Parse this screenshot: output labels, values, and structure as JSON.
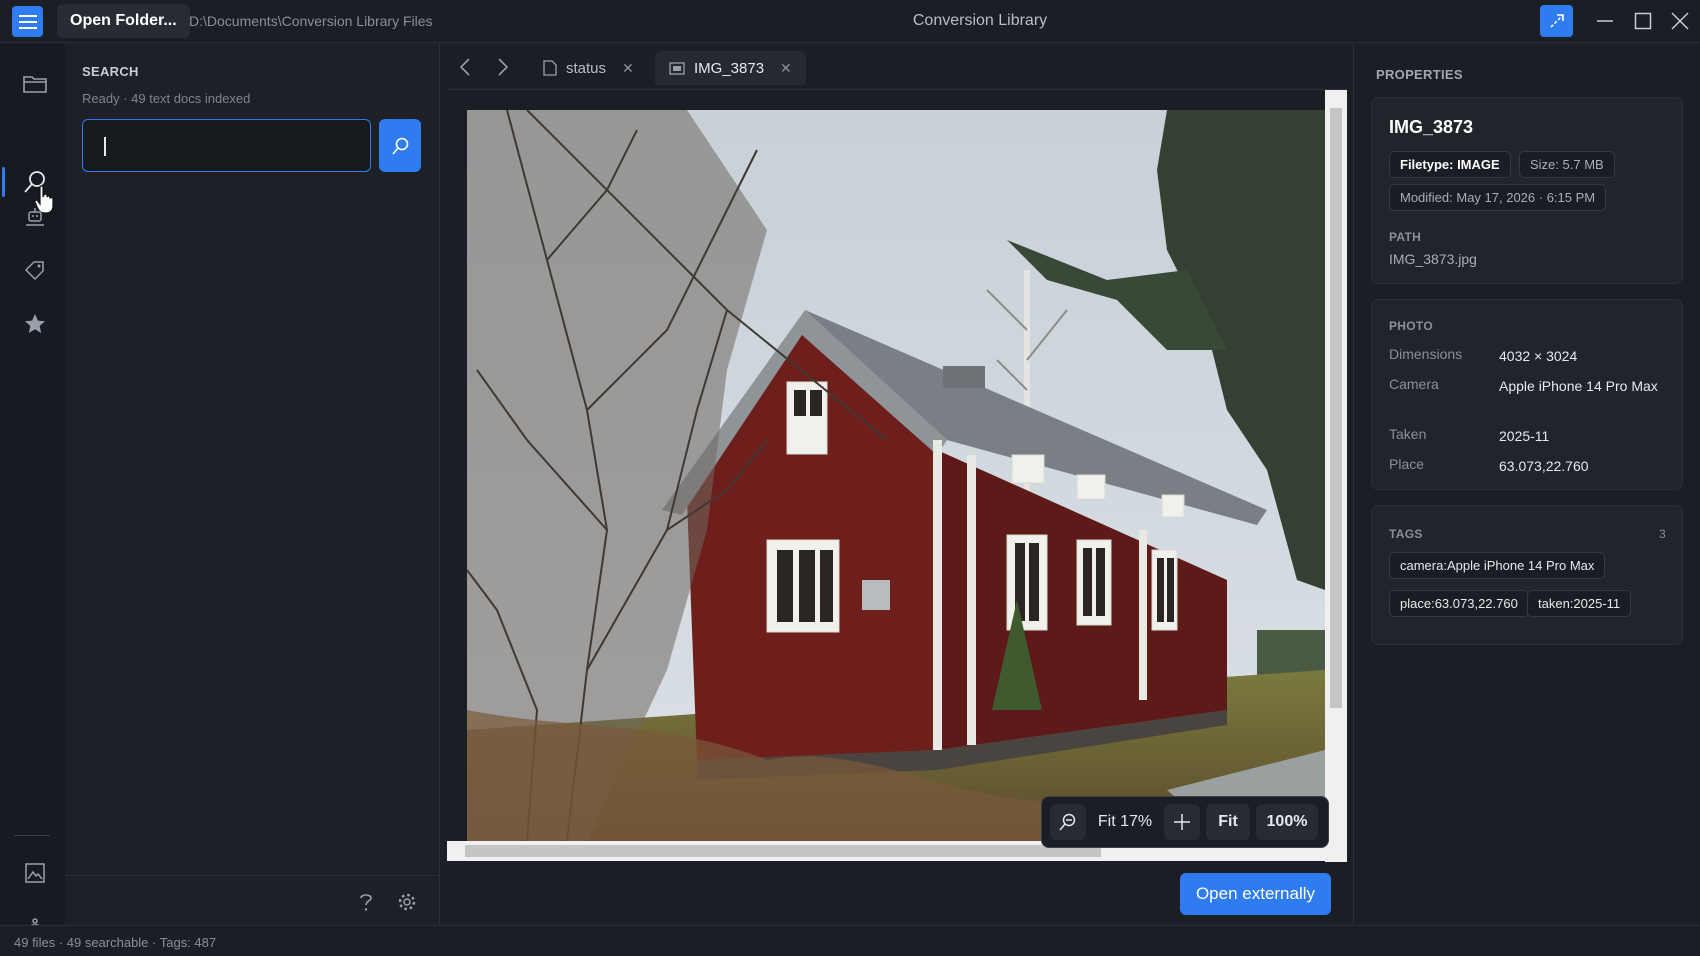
{
  "titlebar": {
    "open_folder_label": "Open Folder...",
    "path": "D:\\Documents\\Conversion Library Files",
    "app_title": "Conversion Library"
  },
  "search": {
    "title": "SEARCH",
    "status": "Ready · 49 text docs indexed",
    "query": "",
    "placeholder": ""
  },
  "tabs": [
    {
      "label": "status",
      "active": false
    },
    {
      "label": "IMG_3873",
      "active": true
    }
  ],
  "viewer": {
    "zoom_label": "Fit 17%",
    "fit_label": "Fit",
    "actual_label": "100%",
    "open_externally_label": "Open externally"
  },
  "properties": {
    "title": "PROPERTIES",
    "file_name": "IMG_3873",
    "filetype": "Filetype: IMAGE",
    "size": "Size: 5.7 MB",
    "modified": "Modified: May 17, 2026 · 6:15 PM",
    "path_label": "PATH",
    "path_value": "IMG_3873.jpg",
    "photo_label": "PHOTO",
    "photo": [
      {
        "key": "Dimensions",
        "value": "4032 × 3024"
      },
      {
        "key": "Camera",
        "value": "Apple iPhone 14 Pro Max"
      },
      {
        "key": "Taken",
        "value": "2025-11"
      },
      {
        "key": "Place",
        "value": "63.073,22.760"
      }
    ],
    "tags_label": "TAGS",
    "tags_count": "3",
    "tags": [
      "camera:Apple iPhone 14 Pro Max",
      "place:63.073,22.760",
      "taken:2025-11"
    ]
  },
  "statusbar": {
    "text": "49 files · 49 searchable · Tags: 487"
  },
  "colors": {
    "accent": "#2f7cf0",
    "background": "#1b1e25",
    "panel": "#1d2027",
    "card": "#20242b"
  }
}
